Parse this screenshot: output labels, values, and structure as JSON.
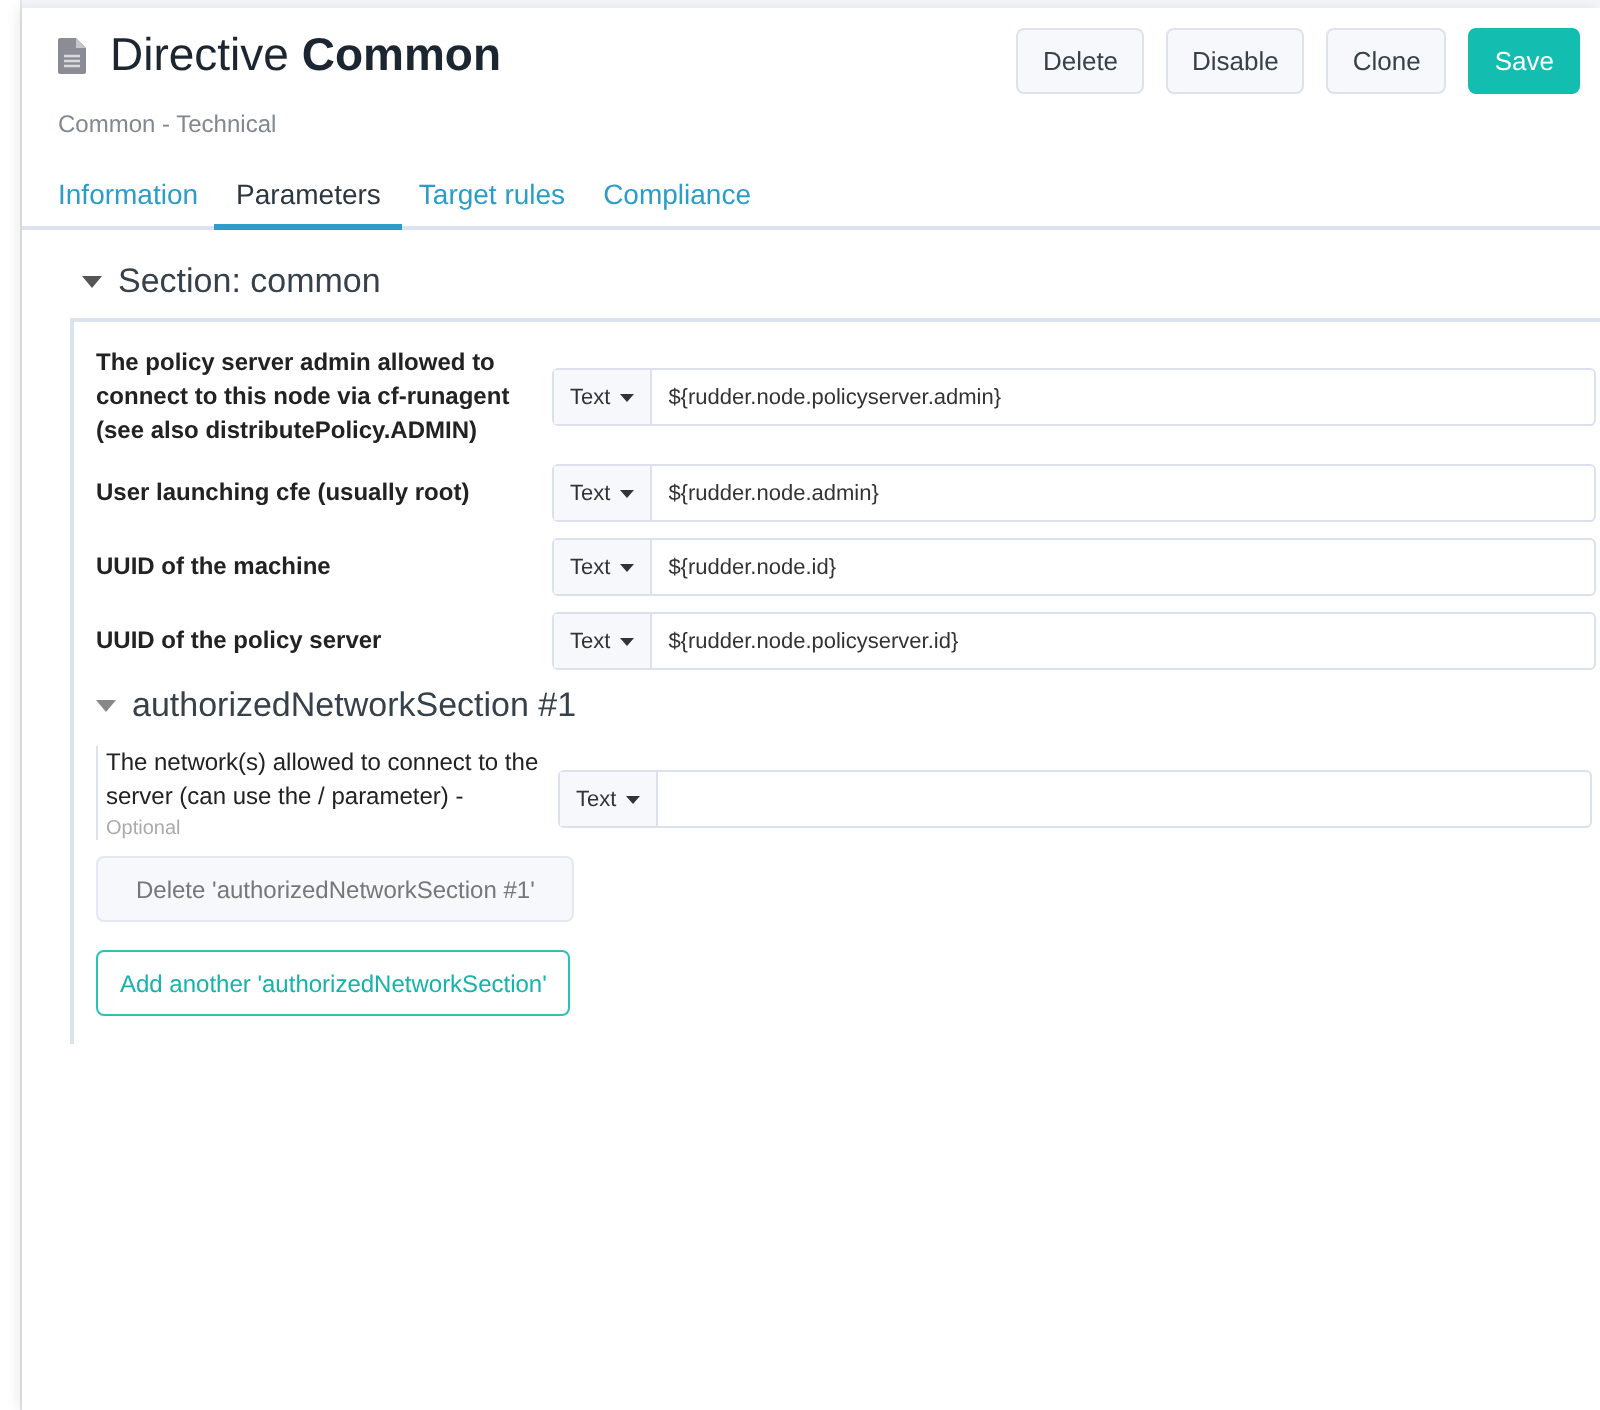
{
  "header": {
    "title": "Directive **Common**",
    "subtitle": "Common - Technical",
    "buttons": [
      {
        "label": "Delete",
        "kind": "plain"
      },
      {
        "label": "Disable",
        "kind": "plain"
      },
      {
        "label": "Clone",
        "kind": "plain"
      },
      {
        "label": "Save",
        "kind": "primary"
      }
    ]
  },
  "tabs": [
    {
      "label": "Information",
      "selected": false
    },
    {
      "label": "Parameters",
      "selected": true
    },
    {
      "label": "Target rules",
      "selected": false
    },
    {
      "label": "Compliance",
      "selected": false
    }
  ],
  "section": {
    "title": "Section: common",
    "expanded": true,
    "fields": [
      {
        "label": "The policy server admin allowed to connect to this node via cf-runagent (see also distributePolicy.ADMIN)",
        "type": "Text",
        "value": "${rudder.node.policyserver.admin}"
      },
      {
        "label": "User launching cfe (usually root)",
        "type": "Text",
        "value": "${rudder.node.admin}"
      },
      {
        "label": "UUID of the machine",
        "type": "Text",
        "value": "${rudder.node.id}"
      },
      {
        "label": "UUID of the policy server",
        "type": "Text",
        "value": "${rudder.node.policyserver.id}"
      }
    ],
    "subsection": {
      "title": "authorizedNetworkSection #1",
      "expanded": true,
      "fields": [
        {
          "label": "The network(s) allowed to connect to the server (can use the / parameter) -",
          "optional": "Optional",
          "type": "Text"
        }
      ],
      "delete_button": "Delete 'authorizedNetworkSection #1'"
    },
    "add_button": "Add another 'authorizedNetworkSection'"
  }
}
